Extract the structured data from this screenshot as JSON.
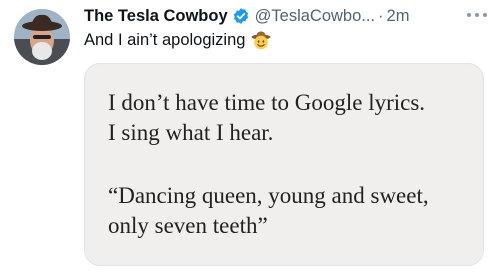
{
  "tweet": {
    "display_name": "The Tesla Cowboy",
    "handle": "@TeslaCowbo...",
    "separator": "·",
    "time": "2m",
    "text": "And I ain’t apologizing",
    "emoji": "cowboy-hat-face"
  },
  "media": {
    "lines_1": [
      "I don’t have time to Google lyrics.",
      "I sing what I hear."
    ],
    "lines_2": [
      "“Dancing queen, young and sweet,",
      "only seven teeth”"
    ],
    "background": "#f1eeee"
  },
  "colors": {
    "verified": "#1d9bf0",
    "secondary_text": "#536471"
  }
}
